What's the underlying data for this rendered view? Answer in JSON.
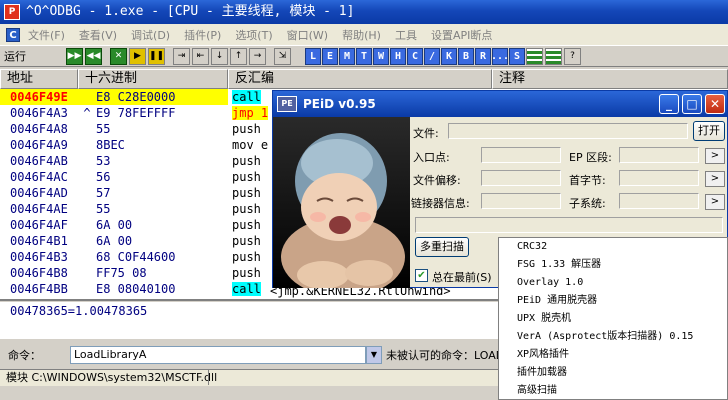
{
  "titlebar": {
    "title": "^O^ODBG - 1.exe - [CPU - 主要线程, 模块 - 1]",
    "logo": "P"
  },
  "menu": {
    "mdi_icon": "C",
    "items": [
      "文件(F)",
      "查看(V)",
      "调试(D)",
      "插件(P)",
      "选项(T)",
      "窗口(W)",
      "帮助(H)",
      "工具",
      "设置API断点"
    ]
  },
  "toolbar": {
    "status": "运行",
    "tool_buttons": [
      {
        "glyph": "▶▶",
        "style": "g"
      },
      {
        "glyph": "◀◀",
        "style": "g"
      },
      {
        "glyph": "✕",
        "style": "g"
      },
      {
        "glyph": "▶",
        "style": "y"
      },
      {
        "glyph": "❚❚",
        "style": "y"
      },
      {
        "glyph": "⇥",
        "style": ""
      },
      {
        "glyph": "⇤",
        "style": ""
      },
      {
        "glyph": "↓",
        "style": ""
      },
      {
        "glyph": "↑",
        "style": ""
      },
      {
        "glyph": "→",
        "style": ""
      },
      {
        "glyph": "⇲",
        "style": ""
      }
    ],
    "letter_buttons": [
      "L",
      "E",
      "M",
      "T",
      "W",
      "H",
      "C",
      "/",
      "K",
      "B",
      "R",
      "...",
      "S"
    ]
  },
  "columns": {
    "address": "地址",
    "hex": "十六进制",
    "disasm": "反汇编",
    "comment": "注释"
  },
  "rows": [
    {
      "addr": "0046F49E",
      "mark": "",
      "hex": "E8 C28E0000",
      "asm": "call",
      "cls": "asm-call",
      "sel": true
    },
    {
      "addr": "0046F4A3",
      "mark": "^",
      "hex": "E9 78FEFFFF",
      "asm": "jmp 1",
      "cls": "asm-jmp",
      "sel": false
    },
    {
      "addr": "0046F4A8",
      "mark": "",
      "hex": "55",
      "asm": "push",
      "cls": "",
      "sel": false
    },
    {
      "addr": "0046F4A9",
      "mark": "",
      "hex": "8BEC",
      "asm": "mov e",
      "cls": "",
      "sel": false
    },
    {
      "addr": "0046F4AB",
      "mark": "",
      "hex": "53",
      "asm": "push",
      "cls": "",
      "sel": false
    },
    {
      "addr": "0046F4AC",
      "mark": "",
      "hex": "56",
      "asm": "push",
      "cls": "",
      "sel": false
    },
    {
      "addr": "0046F4AD",
      "mark": "",
      "hex": "57",
      "asm": "push",
      "cls": "",
      "sel": false
    },
    {
      "addr": "0046F4AE",
      "mark": "",
      "hex": "55",
      "asm": "push",
      "cls": "",
      "sel": false
    },
    {
      "addr": "0046F4AF",
      "mark": "",
      "hex": "6A 00",
      "asm": "push",
      "cls": "",
      "sel": false
    },
    {
      "addr": "0046F4B1",
      "mark": "",
      "hex": "6A 00",
      "asm": "push",
      "cls": "",
      "sel": false
    },
    {
      "addr": "0046F4B3",
      "mark": "",
      "hex": "68 C0F44600",
      "asm": "push",
      "cls": "",
      "sel": false
    },
    {
      "addr": "0046F4B8",
      "mark": "",
      "hex": "FF75 08",
      "asm": "push",
      "cls": "",
      "sel": false
    },
    {
      "addr": "0046F4BB",
      "mark": "",
      "hex": "E8 08040100",
      "asm": "call",
      "cls": "asm-call",
      "sel": false
    }
  ],
  "last_row_comment": "<jmp.&KERNEL32.RtlUnwind>",
  "info": "00478365=1.00478365",
  "command": {
    "label": "命令：",
    "value": "LoadLibraryA",
    "message": "未被认可的命令：LOADLI"
  },
  "statusbar": {
    "text": "模块 C:\\WINDOWS\\system32\\MSCTF.dll"
  },
  "peid": {
    "title": "PEiD v0.95",
    "logo": "PE",
    "file_label": "文件:",
    "open_button": "打开",
    "entry_label": "入口点:",
    "ep_section_label": "EP 区段:",
    "file_offset_label": "文件偏移:",
    "first_byte_label": "首字节:",
    "linker_label": "链接器信息:",
    "subsystem_label": "子系统:",
    "arrow": ">",
    "rescan_button": "多重扫描",
    "ontop_label": "总在最前(S)",
    "ontop_checked": "✔"
  },
  "context_menu": {
    "items": [
      "CRC32",
      "FSG 1.33 解压器",
      "Overlay 1.0",
      "PEiD 通用脱壳器",
      "UPX 脱壳机",
      "VerA (Asprotect版本扫描器) 0.15",
      "XP风格插件",
      "插件加载器",
      "高级扫描"
    ]
  }
}
